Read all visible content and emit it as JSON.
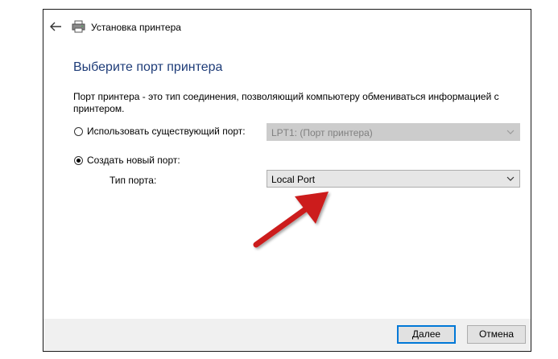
{
  "window": {
    "title": "Установка принтера"
  },
  "main": {
    "heading": "Выберите порт принтера",
    "description": "Порт принтера - это тип соединения, позволяющий компьютеру обмениваться информацией с принтером.",
    "use_existing": {
      "label": "Использовать существующий порт:",
      "selected": false,
      "select_value": "LPT1: (Порт принтера)",
      "enabled": false
    },
    "create_new": {
      "label": "Создать новый порт:",
      "selected": true
    },
    "port_type": {
      "label": "Тип порта:",
      "select_value": "Local Port"
    }
  },
  "footer": {
    "next_label": "Далее",
    "cancel_label": "Отмена"
  },
  "colors": {
    "heading": "#1e3c78",
    "annotation_arrow": "#cc1a1a",
    "primary_border": "#0078d7"
  },
  "icons": [
    "back-arrow-icon",
    "printer-icon",
    "chevron-down-icon"
  ]
}
